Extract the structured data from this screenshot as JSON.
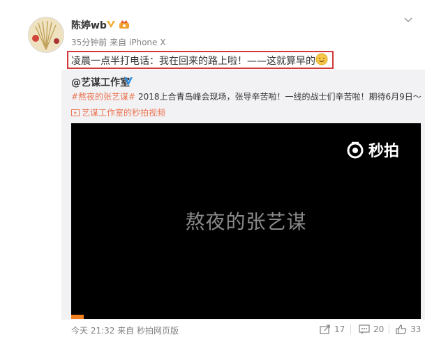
{
  "post": {
    "author": "陈婷wb",
    "meta": "35分钟前 来自 iPhone X",
    "text": "凌晨一点半打电话：我在回来的路上啦！——这就算早的"
  },
  "repost": {
    "author": "@艺谋工作室",
    "hashtag": "#熬夜的张艺谋#",
    "text": " 2018上合青岛峰会现场，张导辛苦啦！一线的战士们辛苦啦！期待6月9日～",
    "video_link": "艺谋工作室的秒拍视频",
    "video": {
      "watermark": "秒拍",
      "title": "熬夜的张艺谋"
    },
    "footer_time": "今天 21:32 来自 秒拍网页版",
    "actions": {
      "forward_count": "17",
      "comment_count": "20",
      "like_count": "33"
    }
  },
  "colors": {
    "highlight_box": "#d23a3a",
    "link": "#eb7350",
    "verify": "#f5a623",
    "repost_verify": "#2b8fe5"
  }
}
